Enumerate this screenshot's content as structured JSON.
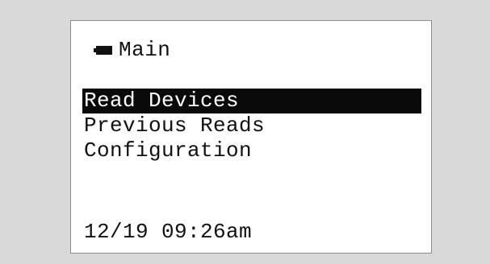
{
  "header": {
    "battery_icon": "battery-icon",
    "title": "Main"
  },
  "menu": {
    "items": [
      {
        "label": "Read Devices",
        "selected": true
      },
      {
        "label": "Previous Reads",
        "selected": false
      },
      {
        "label": "Configuration",
        "selected": false
      }
    ]
  },
  "status": {
    "datetime": "12/19 09:26am"
  },
  "colors": {
    "background": "#d9d9d9",
    "screen": "#ffffff",
    "highlight": "#0a0a0a",
    "text": "#111111"
  }
}
